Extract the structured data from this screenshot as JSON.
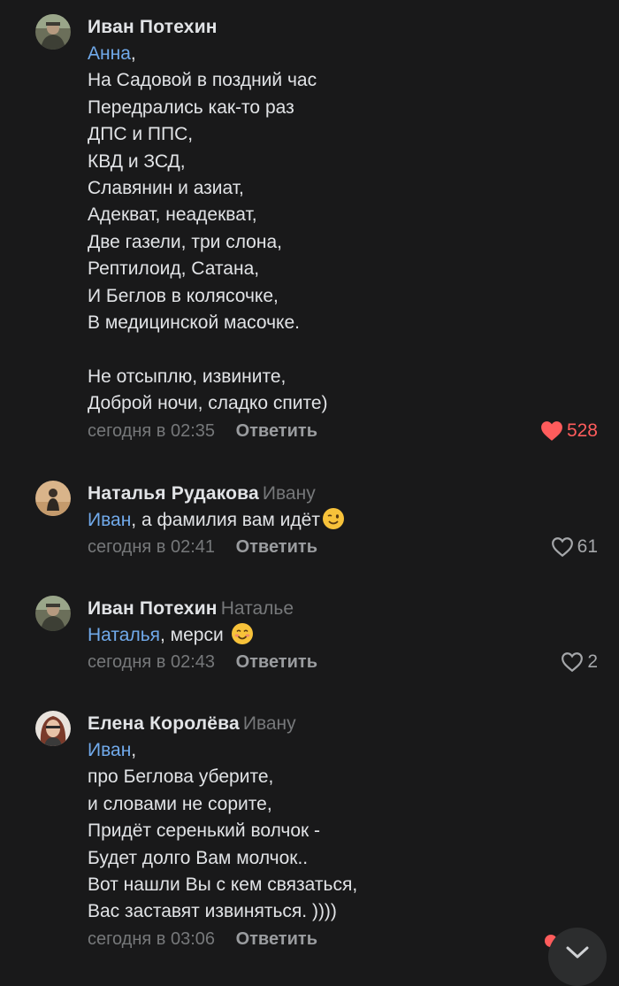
{
  "comments": [
    {
      "author": "Иван Потехин",
      "reply_to": "",
      "mention": "Анна",
      "text_after_mention": ",\nНа Садовой в поздний час\nПередрались как-то раз\nДПС и ППС,\nКВД и ЗСД,\nСлавянин и азиат,\nАдекват, неадекват,\nДве газели, три слона,\nРептилоид, Сатана,\nИ Беглов в колясочке,\nВ медицинской масочке.\n\nНе отсыплю, извините,\nДоброй ночи, сладко спите)",
      "time": "сегодня в 02:35",
      "reply_label": "Ответить",
      "likes": "528",
      "liked": true
    },
    {
      "author": "Наталья Рудакова",
      "reply_to": "Ивану",
      "mention": "Иван",
      "text_after_mention": ", а фамилия вам идёт",
      "emoji": "winking-face",
      "time": "сегодня в 02:41",
      "reply_label": "Ответить",
      "likes": "61",
      "liked": false
    },
    {
      "author": "Иван Потехин",
      "reply_to": "Наталье",
      "mention": "Наталья",
      "text_after_mention": ", мерси ",
      "emoji": "smiling-face",
      "time": "сегодня в 02:43",
      "reply_label": "Ответить",
      "likes": "2",
      "liked": false
    },
    {
      "author": "Елена Королёва",
      "reply_to": "Ивану",
      "mention": "Иван",
      "text_after_mention": ",\nпро Беглова уберите,\nи словами не сорите,\nПридёт серенький волчок -\nБудет долго Вам молчок..\nВот нашли Вы с кем связаться,\nВас заставят извиняться. ))))",
      "time": "сегодня в 03:06",
      "reply_label": "Ответить"
    }
  ],
  "colors": {
    "background": "#19191a",
    "text": "#e1e3e6",
    "secondary": "#76787a",
    "mention": "#71aaeb",
    "like_active": "#ff5c5c"
  },
  "icons": {
    "like_filled": "heart-filled-icon",
    "like_outline": "heart-outline-icon",
    "scroll_down": "chevron-down-icon"
  }
}
